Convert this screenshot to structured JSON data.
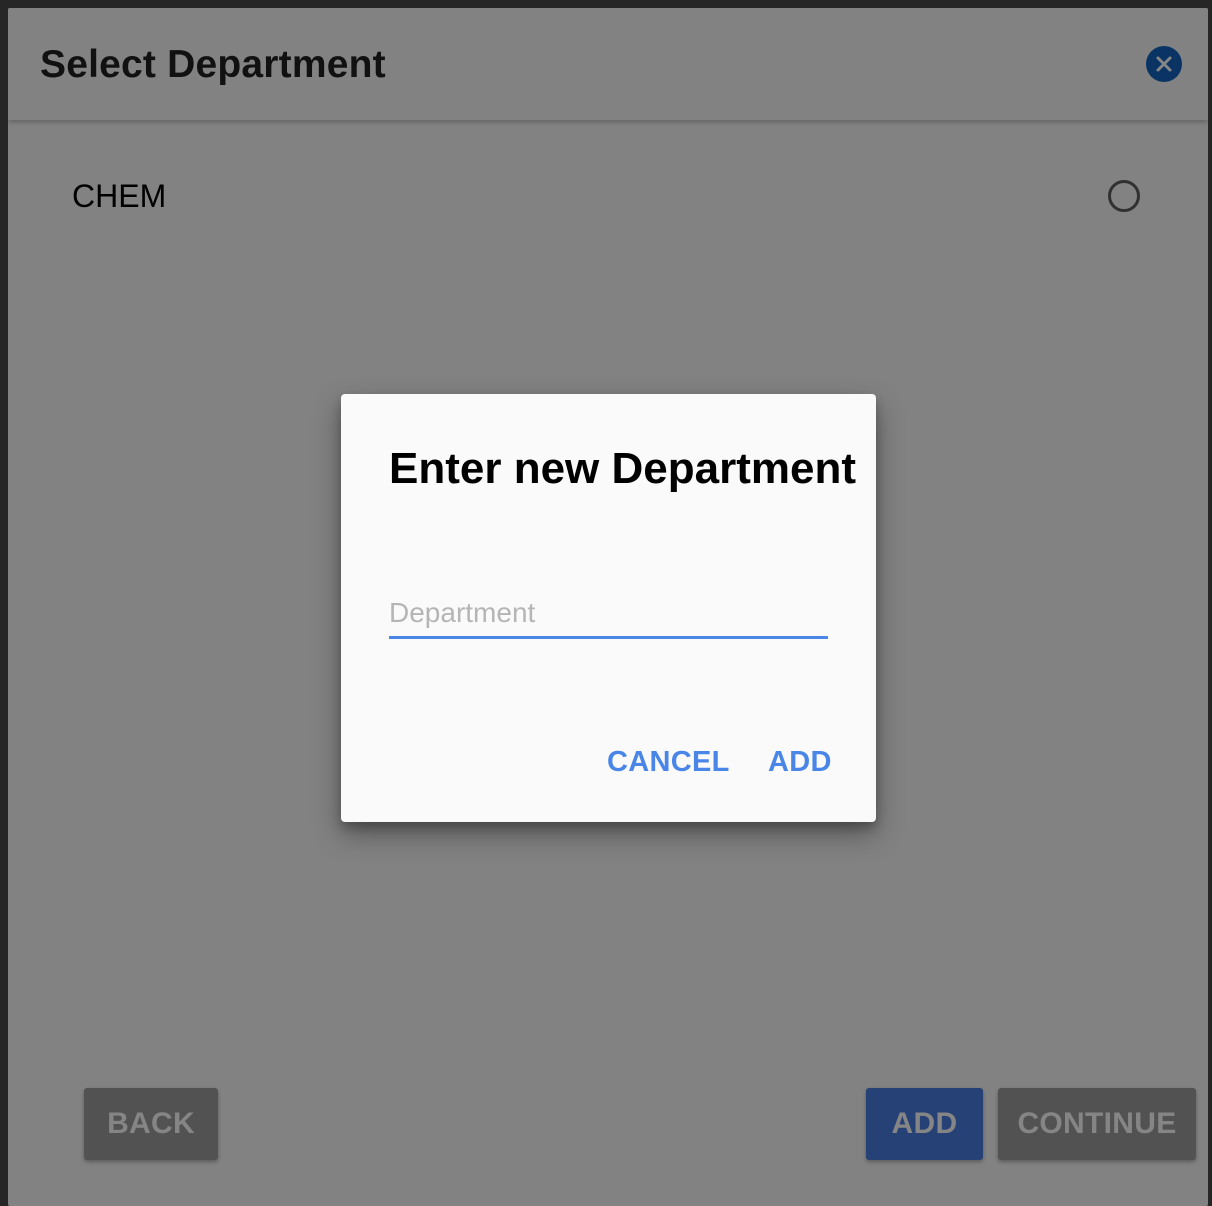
{
  "page": {
    "title": "Select Department",
    "close_icon": "close-icon"
  },
  "departments": [
    {
      "label": "CHEM",
      "selected": false
    }
  ],
  "footer": {
    "back_label": "BACK",
    "add_label": "ADD",
    "continue_label": "CONTINUE"
  },
  "dialog": {
    "title": "Enter new Department",
    "input": {
      "placeholder": "Department",
      "value": ""
    },
    "cancel_label": "CANCEL",
    "add_label": "ADD"
  },
  "colors": {
    "accent": "#4a86e8",
    "close_button": "#1565c0",
    "primary_button": "#4a7ee0",
    "disabled_button": "#9e9e9e"
  }
}
